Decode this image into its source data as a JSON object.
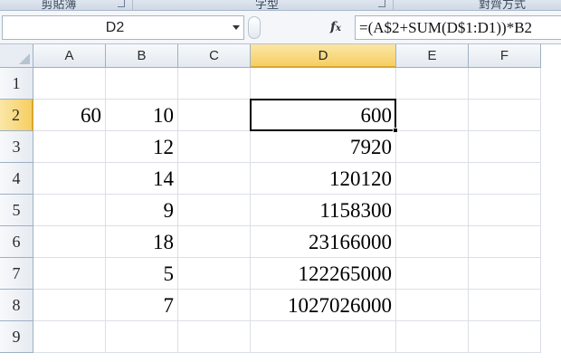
{
  "ribbon": {
    "groups": [
      {
        "label": "剪貼簿"
      },
      {
        "label": "字型"
      },
      {
        "label": "對齊方式"
      }
    ]
  },
  "formula_bar": {
    "name_box": "D2",
    "fx_icon": "function-icon",
    "formula": "=(A$2+SUM(D$1:D1))*B2"
  },
  "sheet": {
    "columns": [
      "A",
      "B",
      "C",
      "D",
      "E",
      "F"
    ],
    "rows": [
      "1",
      "2",
      "3",
      "4",
      "5",
      "6",
      "7",
      "8",
      "9"
    ],
    "selected_column": "D",
    "selected_row": "2",
    "cells": {
      "A2": "60",
      "B2": "10",
      "B3": "12",
      "B4": "14",
      "B5": "9",
      "B6": "18",
      "B7": "5",
      "B8": "7",
      "D2": "600",
      "D3": "7920",
      "D4": "120120",
      "D5": "1158300",
      "D6": "23166000",
      "D7": "122265000",
      "D8": "1027026000"
    }
  },
  "colors": {
    "selected_header": "#f6cf62",
    "gridline": "#dadfe6",
    "header_border": "#9eb0c5"
  }
}
